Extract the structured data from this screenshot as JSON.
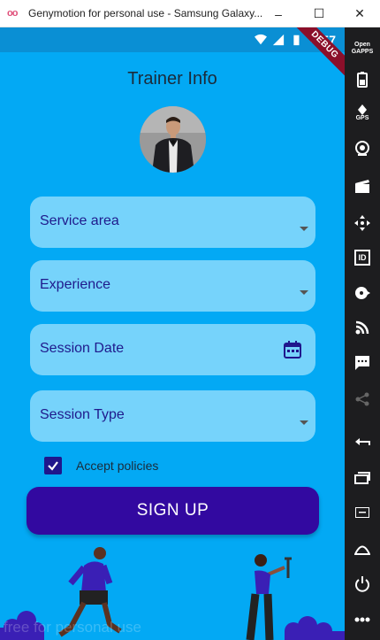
{
  "window": {
    "logo": "oo",
    "title": "Genymotion for personal use - Samsung Galaxy...",
    "minimize": "–",
    "maximize": "☐",
    "close": "✕"
  },
  "statusbar": {
    "time": "4:57",
    "debug_banner": "DEBUG"
  },
  "screen": {
    "title": "Trainer Info"
  },
  "form": {
    "service_area": {
      "label": "Service area",
      "icon": "chevron-down-icon"
    },
    "experience": {
      "label": "Experience",
      "icon": "chevron-down-icon"
    },
    "session_date": {
      "label": "Session Date",
      "icon": "calendar-icon"
    },
    "session_type": {
      "label": "Session Type",
      "icon": "chevron-down-icon"
    },
    "accept_policies": {
      "label": "Accept policies",
      "checked": true
    },
    "signup_label": "SIGN UP"
  },
  "watermark": "free for personal use",
  "sidebar": {
    "open_gapps": "Open GAPPS",
    "gps": "GPS",
    "id": "ID"
  },
  "colors": {
    "background": "#03a9f4",
    "field": "#76d3fb",
    "accent": "#3209a0",
    "label_text": "#1f1a8c"
  }
}
